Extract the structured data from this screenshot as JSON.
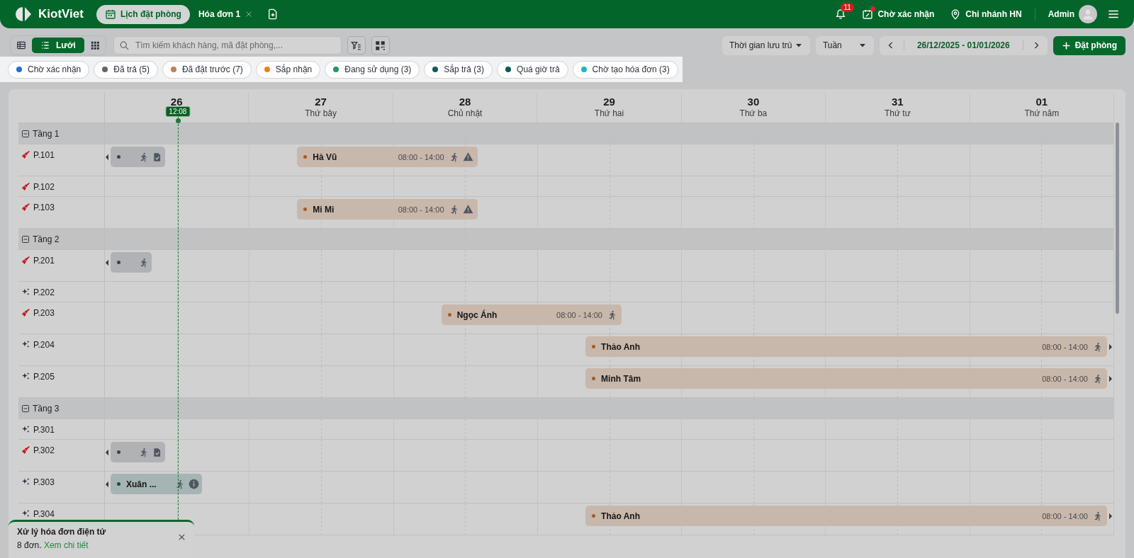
{
  "header": {
    "brand": "KiotViet",
    "tabs": [
      {
        "label": "Lịch đặt phòng",
        "selected": true,
        "closable": false
      },
      {
        "label": "Hóa đơn 1",
        "selected": false,
        "closable": true
      }
    ],
    "notifications": {
      "count": "11"
    },
    "pending": {
      "label": "Chờ xác nhận",
      "alert": true
    },
    "branch": "Chi nhánh HN",
    "user": "Admin"
  },
  "toolbar": {
    "views": [
      {
        "kind": "list",
        "selected": false
      },
      {
        "kind": "timeline",
        "label": "Lưới",
        "selected": true
      },
      {
        "kind": "grid",
        "selected": false
      }
    ],
    "search": {
      "placeholder": "Tìm kiếm khách hàng, mã đặt phòng,..."
    },
    "time_filter": "Thời gian lưu trú",
    "period": "Tuần",
    "date_range": "26/12/2025 - 01/01/2026",
    "book_button": "Đặt phòng"
  },
  "statuses": [
    {
      "label": "Chờ xác nhận",
      "color": "#1a6fe0"
    },
    {
      "label": "Đã trả (5)",
      "color": "#5f6773"
    },
    {
      "label": "Đã đặt trước (7)",
      "color": "#c0805a"
    },
    {
      "label": "Sắp nhận",
      "color": "#f07f1a"
    },
    {
      "label": "Đang sử dụng (3)",
      "color": "#27975a"
    },
    {
      "label": "Sắp trả (3)",
      "color": "#0e5c5c"
    },
    {
      "label": "Quá giờ trả",
      "color": "#0c5a55"
    },
    {
      "label": "Chờ tạo hóa đơn (3)",
      "color": "#1cb5c4"
    }
  ],
  "calendar": {
    "now": {
      "label": "12:08"
    },
    "days": [
      {
        "date": "26"
      },
      {
        "date": "27",
        "weekday": "Thứ bảy"
      },
      {
        "date": "28",
        "weekday": "Chủ nhật"
      },
      {
        "date": "29",
        "weekday": "Thứ hai"
      },
      {
        "date": "30",
        "weekday": "Thứ ba"
      },
      {
        "date": "31",
        "weekday": "Thứ tư"
      },
      {
        "date": "01",
        "weekday": "Thứ năm"
      }
    ],
    "floors": [
      {
        "name": "Tầng 1",
        "expanded": true,
        "rooms": [
          {
            "name": "P.101",
            "clean": false,
            "bookings": [
              {
                "color": "#3a4350",
                "checked_in": true,
                "invoiced": true
              },
              {
                "color": "#a65b22",
                "guest": "Hà Vũ",
                "time": "08:00 - 14:00",
                "checked_in": true,
                "warning": true
              }
            ]
          },
          {
            "name": "P.102",
            "clean": false
          },
          {
            "name": "P.103",
            "clean": false,
            "bookings": [
              {
                "color": "#a65b22",
                "guest": "Mi Mi",
                "time": "08:00 - 14:00",
                "checked_in": true,
                "warning": true
              }
            ]
          }
        ]
      },
      {
        "name": "Tầng 2",
        "expanded": true,
        "rooms": [
          {
            "name": "P.201",
            "clean": false,
            "bookings": [
              {
                "color": "#3a4350",
                "checked_in": true
              }
            ]
          },
          {
            "name": "P.202",
            "clean": true
          },
          {
            "name": "P.203",
            "clean": false,
            "bookings": [
              {
                "color": "#a65b22",
                "guest": "Ngọc Ánh",
                "time": "08:00 - 14:00",
                "checked_in": true
              }
            ]
          },
          {
            "name": "P.204",
            "clean": true,
            "bookings": [
              {
                "color": "#a65b22",
                "guest": "Thảo Anh",
                "time": "08:00 - 14:00",
                "checked_in": true
              }
            ]
          },
          {
            "name": "P.205",
            "clean": true,
            "bookings": [
              {
                "color": "#a65b22",
                "guest": "Minh Tâm",
                "time": "08:00 - 14:00",
                "checked_in": true
              }
            ]
          }
        ]
      },
      {
        "name": "Tầng 3",
        "expanded": true,
        "rooms": [
          {
            "name": "P.301",
            "clean": true
          },
          {
            "name": "P.302",
            "clean": false,
            "bookings": [
              {
                "color": "#3a4350",
                "checked_in": true,
                "invoiced": true
              }
            ]
          },
          {
            "name": "P.303",
            "clean": true,
            "bookings": [
              {
                "color": "#0f4f4b",
                "guest": "Xuân ...",
                "checked_in": true,
                "note": true
              }
            ]
          },
          {
            "name": "P.304",
            "clean": true,
            "bookings": [
              {
                "color": "#a65b22",
                "guest": "Thảo Anh",
                "time": "08:00 - 14:00",
                "checked_in": true
              }
            ]
          }
        ]
      }
    ]
  },
  "toast": {
    "title": "Xử lý hóa đơn điện tử",
    "message": "8 đơn.",
    "link": "Xem chi tiết"
  }
}
